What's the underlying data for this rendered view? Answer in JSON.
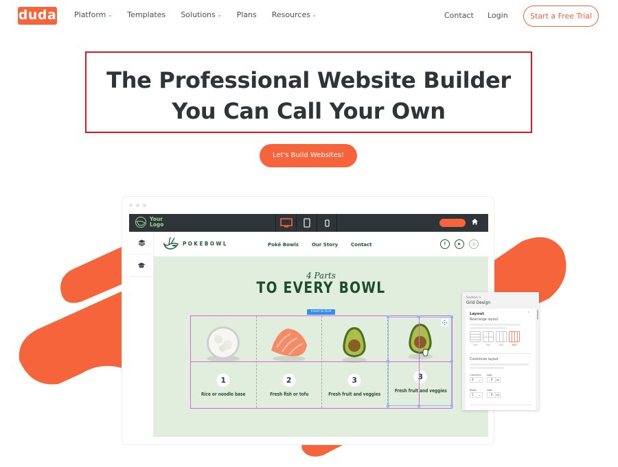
{
  "brand": {
    "logo_text": "duda",
    "accent_color": "#f5643a",
    "dark_color": "#2f3437"
  },
  "nav": {
    "items": [
      {
        "label": "Platform",
        "has_dropdown": true
      },
      {
        "label": "Templates",
        "has_dropdown": false
      },
      {
        "label": "Solutions",
        "has_dropdown": true
      },
      {
        "label": "Plans",
        "has_dropdown": false
      },
      {
        "label": "Resources",
        "has_dropdown": true
      }
    ],
    "dropdown_glyph": "⌄",
    "contact": "Contact",
    "login": "Login",
    "trial_button": "Start a Free Trial"
  },
  "hero": {
    "title_line1": "The Professional Website Builder",
    "title_line2": "You Can Call Your Own",
    "cta_button": "Let's Build Websites!",
    "highlight_color": "#e8141b"
  },
  "editor": {
    "logo_text_line1": "Your",
    "logo_text_line2": "Logo",
    "devices": [
      "desktop-icon",
      "tablet-icon",
      "mobile-icon"
    ],
    "active_device": "desktop",
    "sidebar_icons": [
      "layers-icon",
      "graduation-cap-icon"
    ]
  },
  "site_preview": {
    "brand_name": "POKEBOWL",
    "nav_links": [
      "Pokē Bowls",
      "Our Story",
      "Contact"
    ],
    "social": [
      {
        "name": "facebook-icon",
        "glyph": "f"
      },
      {
        "name": "youtube-icon",
        "glyph": "▶"
      },
      {
        "name": "instagram-icon",
        "glyph": "◎"
      }
    ],
    "script_heading": "4 Parts",
    "heading": "TO EVERY BOWL",
    "insert_tag": "Insert to Grid",
    "items": [
      {
        "number": "1",
        "caption": "Rice or noodle base",
        "food": "rice"
      },
      {
        "number": "2",
        "caption": "Fresh fish or tofu",
        "food": "salmon"
      },
      {
        "number": "3",
        "caption": "Fresh fruit and veggies",
        "food": "avocado"
      },
      {
        "number": "3",
        "caption": "Fresh fruit and veggies",
        "food": "avocado"
      }
    ],
    "background_color": "#e2eedd",
    "text_color": "#1b4d2d"
  },
  "panel": {
    "breadcrumb": "Section >",
    "title": "Grid Design",
    "section": "Layout",
    "rearrange_label": "Rearrange layout",
    "layout_options": [
      {
        "label": "1x4",
        "active": false
      },
      {
        "label": "2x2",
        "active": false
      },
      {
        "label": "3x1",
        "active": false
      },
      {
        "label": "4x1",
        "active": true
      }
    ],
    "customize_label": "Customize layout",
    "columns_label": "Columns",
    "columns_value": "4",
    "rows_label": "Rows",
    "rows_value": "1",
    "gap_label": "Gap",
    "col_gap_value": "0",
    "row_gap_value": "0",
    "unit": "px"
  }
}
